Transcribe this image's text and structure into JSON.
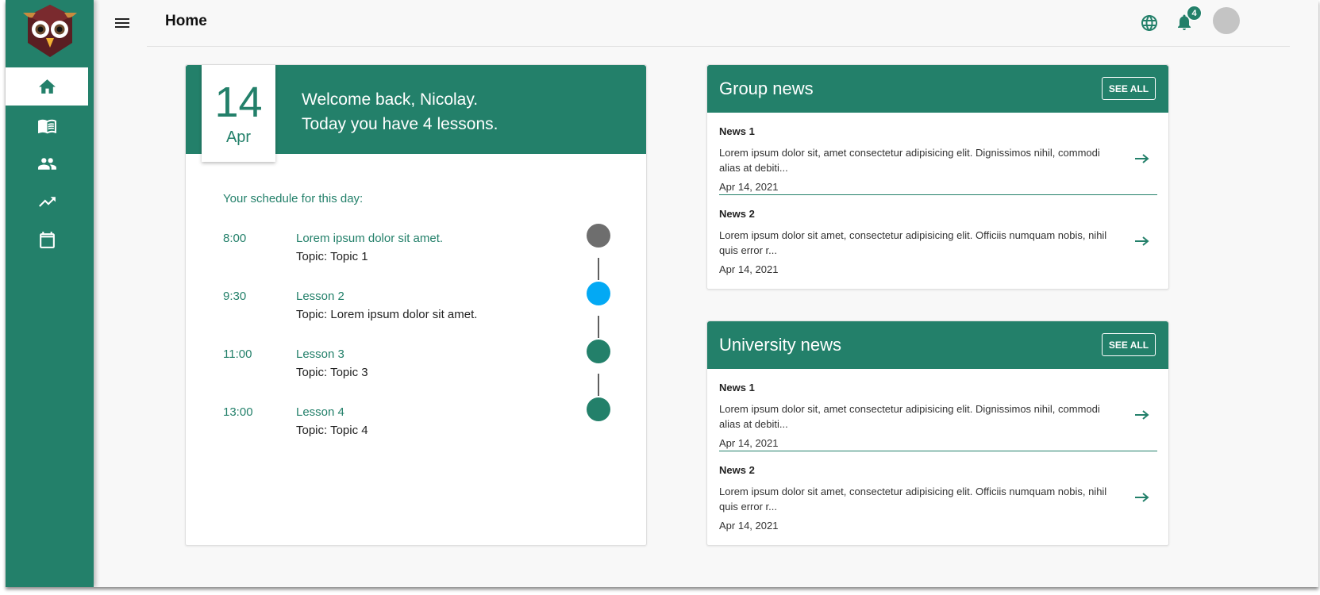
{
  "header": {
    "title": "Home",
    "notification_count": "4"
  },
  "sidebar": {
    "items": [
      {
        "name": "home",
        "icon": "home-icon",
        "active": true
      },
      {
        "name": "courses",
        "icon": "book-icon",
        "active": false
      },
      {
        "name": "groups",
        "icon": "people-icon",
        "active": false
      },
      {
        "name": "progress",
        "icon": "trending-up-icon",
        "active": false
      },
      {
        "name": "calendar",
        "icon": "calendar-icon",
        "active": false
      }
    ]
  },
  "schedule": {
    "day": "14",
    "month": "Apr",
    "welcome_line1": "Welcome back, Nicolay.",
    "welcome_line2": "Today you have 4 lessons.",
    "heading": "Your schedule for this day:",
    "lessons": [
      {
        "time": "8:00",
        "title": "Lorem ipsum dolor sit amet.",
        "topic": "Topic: Topic 1",
        "dot_color": "#6e6e6e"
      },
      {
        "time": "9:30",
        "title": "Lesson 2",
        "topic": "Topic: Lorem ipsum dolor sit amet.",
        "dot_color": "#03a9f4"
      },
      {
        "time": "11:00",
        "title": "Lesson 3",
        "topic": "Topic: Topic 3",
        "dot_color": "#23806a"
      },
      {
        "time": "13:00",
        "title": "Lesson 4",
        "topic": "Topic: Topic 4",
        "dot_color": "#23806a"
      }
    ]
  },
  "group_news": {
    "title": "Group news",
    "see_all": "SEE ALL",
    "items": [
      {
        "title": "News 1",
        "text": "Lorem ipsum dolor sit, amet consectetur adipisicing elit. Dignissimos nihil, commodi alias at debiti...",
        "date": "Apr 14, 2021"
      },
      {
        "title": "News 2",
        "text": "Lorem ipsum dolor sit amet, consectetur adipisicing elit. Officiis numquam nobis, nihil quis error r...",
        "date": "Apr 14, 2021"
      }
    ]
  },
  "university_news": {
    "title": "University news",
    "see_all": "SEE ALL",
    "items": [
      {
        "title": "News 1",
        "text": "Lorem ipsum dolor sit, amet consectetur adipisicing elit. Dignissimos nihil, commodi alias at debiti...",
        "date": "Apr 14, 2021"
      },
      {
        "title": "News 2",
        "text": "Lorem ipsum dolor sit amet, consectetur adipisicing elit. Officiis numquam nobis, nihil quis error r...",
        "date": "Apr 14, 2021"
      }
    ]
  },
  "colors": {
    "primary": "#23806a",
    "accent_blue": "#03a9f4",
    "inactive_dot": "#6e6e6e"
  }
}
